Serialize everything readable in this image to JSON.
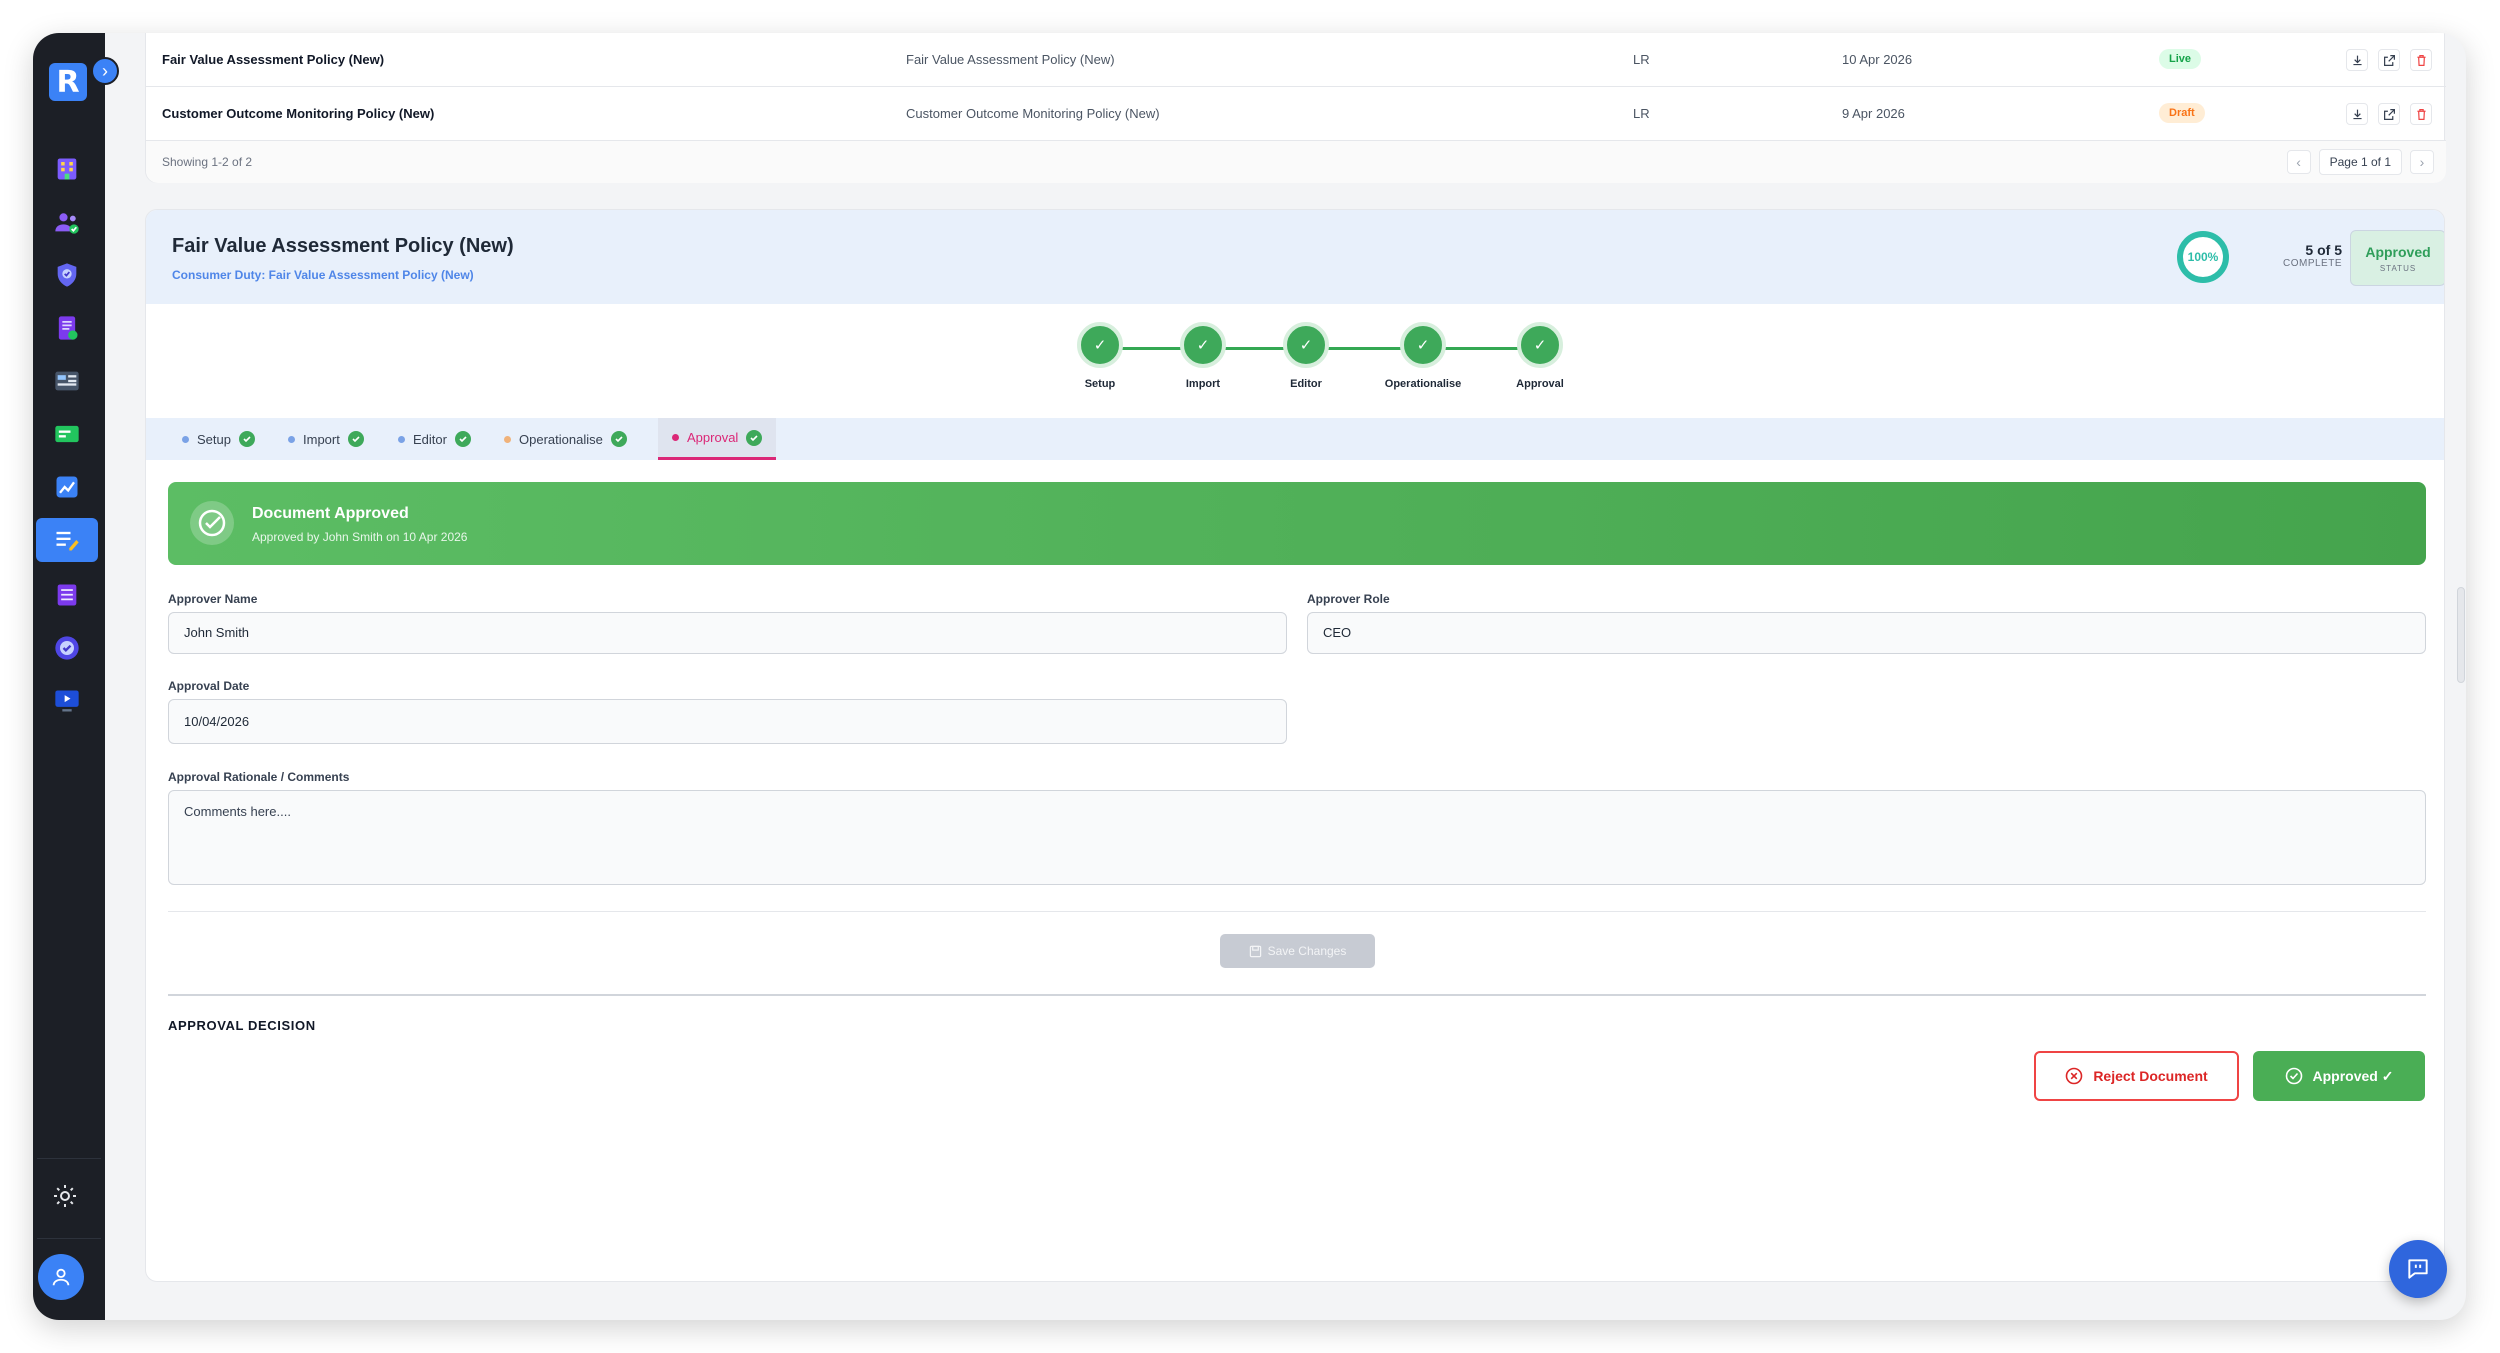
{
  "table": {
    "rows": [
      {
        "title": "Fair Value Assessment Policy (New)",
        "description": "Fair Value Assessment Policy (New)",
        "owner": "LR",
        "date": "10 Apr 2026",
        "status": "Live"
      },
      {
        "title": "Customer Outcome Monitoring Policy (New)",
        "description": "Customer Outcome Monitoring Policy (New)",
        "owner": "LR",
        "date": "9 Apr 2026",
        "status": "Draft"
      }
    ],
    "showing": "Showing 1-2 of 2",
    "page_label": "Page 1 of 1",
    "prev": "‹",
    "next": "›"
  },
  "sidebar": {
    "logo": "R",
    "expand": "›"
  },
  "detail": {
    "title": "Fair Value Assessment Policy (New)",
    "subtitle": "Consumer Duty: Fair Value Assessment Policy (New)",
    "progress": "100%",
    "progress_value": 1.0,
    "count": "5 of 5",
    "count_label": "COMPLETE",
    "status": "Approved",
    "status_label": "STATUS"
  },
  "steps": [
    {
      "label": "Setup"
    },
    {
      "label": "Import"
    },
    {
      "label": "Editor"
    },
    {
      "label": "Operationalise"
    },
    {
      "label": "Approval"
    }
  ],
  "tabs": [
    {
      "label": "Setup",
      "bullet_color": "#7aa2e6"
    },
    {
      "label": "Import",
      "bullet_color": "#7aa2e6"
    },
    {
      "label": "Editor",
      "bullet_color": "#7aa2e6"
    },
    {
      "label": "Operationalise",
      "bullet_color": "#f0b27a"
    },
    {
      "label": "Approval",
      "bullet_color": "#db2777"
    }
  ],
  "banner": {
    "title": "Document Approved",
    "subtitle": "Approved by John Smith on 10 Apr 2026"
  },
  "form": {
    "approver_name_label": "Approver Name",
    "approver_name": "John Smith",
    "approver_role_label": "Approver Role",
    "approver_role": "CEO",
    "approval_date_label": "Approval Date",
    "approval_date": "10/04/2026",
    "comments_label": "Approval Rationale / Comments",
    "comments": "Comments here...."
  },
  "actions": {
    "save": "Save Changes",
    "section_title": "APPROVAL DECISION",
    "reject": "Reject Document",
    "approved": "Approved ✓"
  },
  "colors": {
    "accent": "#3b82f6",
    "success": "#4aae55",
    "danger": "#ef4444",
    "active_tab": "#db2777"
  }
}
